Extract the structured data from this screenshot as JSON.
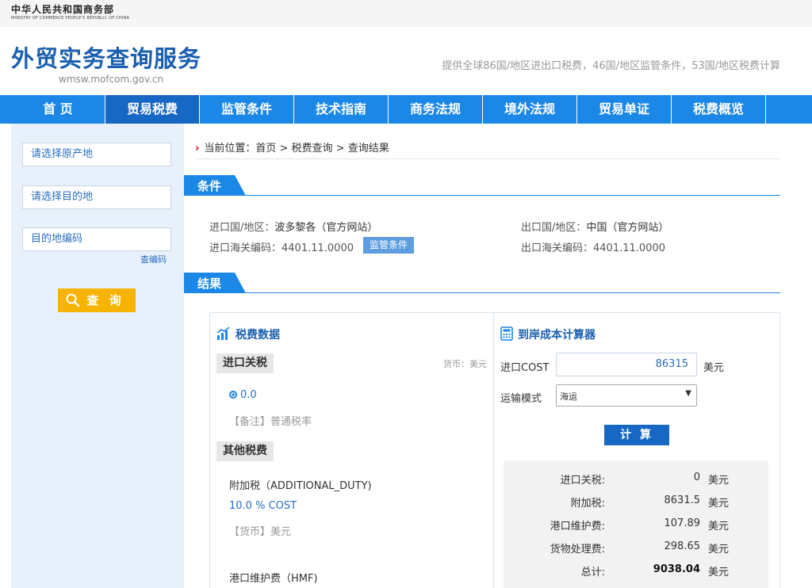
{
  "ministry": {
    "name_cn": "中华人民共和国商务部",
    "name_en": "MINISTRY OF COMMERCE PEOPLE'S REPUBLIC OF CHINA"
  },
  "header": {
    "title": "外贸实务查询服务",
    "url": "wmsw.mofcom.gov.cn",
    "description": "提供全球86国/地区进出口税费，46国/地区监管条件，53国/地区税费计算"
  },
  "nav": {
    "items": [
      "首 页",
      "贸易税费",
      "监管条件",
      "技术指南",
      "商务法规",
      "境外法规",
      "贸易单证",
      "税费概览"
    ],
    "active_index": 1
  },
  "sidebar": {
    "origin_placeholder": "请选择原产地",
    "destination_placeholder": "请选择目的地",
    "code_placeholder": "目的地编码",
    "lookup_code_link": "查编码",
    "query_button": "查 询"
  },
  "breadcrumb": {
    "prefix": "当前位置：",
    "path": "首页 > 税费查询 > 查询结果"
  },
  "conditions": {
    "section_label": "条件",
    "import_country_label": "进口国/地区：",
    "import_country": "波多黎各",
    "import_site": "（官方网站）",
    "import_code_label": "进口海关编码：",
    "import_code": "4401.11.0000",
    "regulatory_badge": "监管条件",
    "export_country_label": "出口国/地区：",
    "export_country": "中国",
    "export_site": "（官方网站）",
    "export_code_label": "出口海关编码：",
    "export_code": "4401.11.0000"
  },
  "results": {
    "section_label": "结果",
    "tax_panel": {
      "title": "税费数据",
      "import_duty_label": "进口关税",
      "currency_note": "货币：美元",
      "duty_value": "0.0",
      "duty_note": "【备注】普通税率",
      "other_label": "其他税费",
      "additional_duty_name": "附加税（ADDITIONAL_DUTY)",
      "additional_duty_rate": "10.0 % COST",
      "additional_currency": "【货币】美元",
      "hmf_name": "港口维护费（HMF)"
    },
    "calculator": {
      "title": "到岸成本计算器",
      "cost_label": "进口COST",
      "cost_value": "86315",
      "cost_unit": "美元",
      "transport_label": "运输模式",
      "transport_value": "海运",
      "calc_button": "计 算",
      "rows": [
        {
          "label": "进口关税:",
          "value": "0",
          "unit": "美元"
        },
        {
          "label": "附加税:",
          "value": "8631.5",
          "unit": "美元"
        },
        {
          "label": "港口维护费:",
          "value": "107.89",
          "unit": "美元"
        },
        {
          "label": "货物处理费:",
          "value": "298.65",
          "unit": "美元"
        },
        {
          "label": "总计:",
          "value": "9038.04",
          "unit": "美元"
        }
      ]
    }
  },
  "colors": {
    "nav_blue": "#1b87e6",
    "nav_active": "#1768c4",
    "title_blue": "#1b5fb0",
    "query_yellow": "#f6b300",
    "sidebar_bg": "#e8f1fb"
  }
}
